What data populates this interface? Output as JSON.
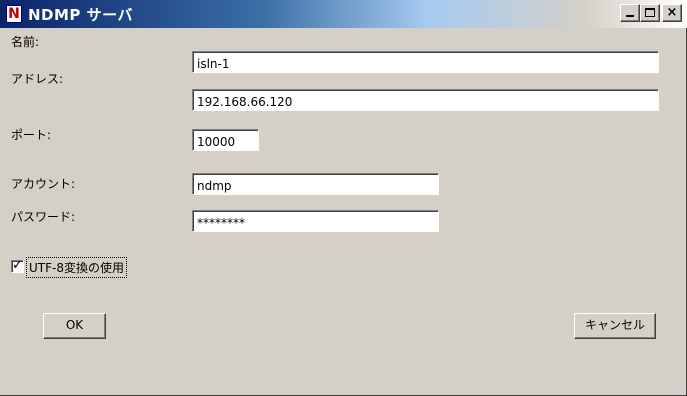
{
  "window": {
    "title": "NDMP サーバ",
    "icon": "N",
    "controls": {
      "minimize": "minimize-icon",
      "maximize": "maximize-icon",
      "close": "×"
    }
  },
  "form": {
    "name": {
      "label": "名前:",
      "value": "isln-1"
    },
    "address": {
      "label": "アドレス:",
      "value": "192.168.66.120"
    },
    "port": {
      "label": "ポート:",
      "value": "10000"
    },
    "account": {
      "label": "アカウント:",
      "value": "ndmp"
    },
    "password": {
      "label": "パスワード:",
      "value": "********"
    },
    "utf8": {
      "label": "UTF-8変換の使用",
      "checked": true,
      "mark": "✓"
    }
  },
  "buttons": {
    "ok": "OK",
    "cancel": "キャンセル"
  }
}
